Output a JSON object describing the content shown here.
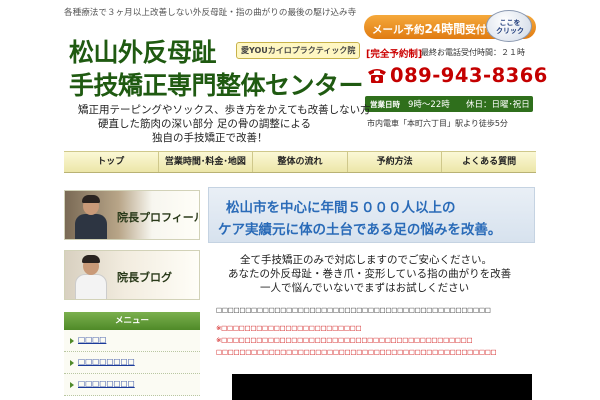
{
  "header": {
    "tagline": "各種療法で３ヶ月以上改善しない外反母趾・指の曲がりの最後の駆け込み寺",
    "title_line1": "松山外反母趾",
    "title_line2": "手技矯正専門整体センター",
    "clinic_badge": "愛YOUカイロプラクティック院",
    "mail_banner_prefix": "メール予約",
    "mail_banner_bold": "24時間",
    "mail_banner_suffix": "受付中！",
    "click_button": "ここを\nクリック",
    "reserve_label": "[完全予約制]",
    "last_call": "最終お電話受付時間：２１時",
    "phone": "089-943-8366",
    "hours_label": "営業日時",
    "hours_value": "9時～22時",
    "closed": "休日：日曜･祝日",
    "access": "市内電車「本町六丁目」駅より徒歩5分",
    "description": [
      "矯正用テーピングやソックス、歩き方をかえても改善しない方",
      "硬直した筋肉の深い部分 足の骨の調整による",
      "独自の手技矯正で改善！"
    ]
  },
  "nav": {
    "items": [
      "トップ",
      "営業時間･料金･地図",
      "整体の流れ",
      "予約方法",
      "よくある質問"
    ]
  },
  "sidebar": {
    "banners": [
      "院長プロフィール",
      "院長ブログ"
    ],
    "menu_title": "メニュー",
    "menu_items": [
      "□□□□",
      "□□□□□□□□",
      "□□□□□□□□"
    ]
  },
  "main": {
    "hero_line1": "松山市を中心に年間５０００人以上の",
    "hero_line2": "ケア実績元に体の土台である足の悩みを改善。",
    "body": [
      "全て手技矯正のみで対応しますのでご安心ください。",
      "あなたの外反母趾・巻き爪・変形している指の曲がりを改善",
      "一人で悩んでいないでまずはお試しください"
    ],
    "placeholder_line": "□□□□□□□□□□□□□□□□□□□□□□□□□□□□□□□□□□□□□□□□□□□□□□□",
    "red_lines": [
      "※□□□□□□□□□□□□□□□□□□□□□□□□",
      "※□□□□□□□□□□□□□□□□□□□□□□□□□□□□□□□□□□□□□□□□□□□",
      "□□□□□□□□□□□□□□□□□□□□□□□□□□□□□□□□□□□□□□□□□□□□□□□□"
    ]
  },
  "colors": {
    "title_green": "#1f5a11",
    "phone_red": "#c40000",
    "hero_blue": "#2a6bb8",
    "mail_orange": "#e07b12",
    "menu_green": "#4f8a28"
  }
}
